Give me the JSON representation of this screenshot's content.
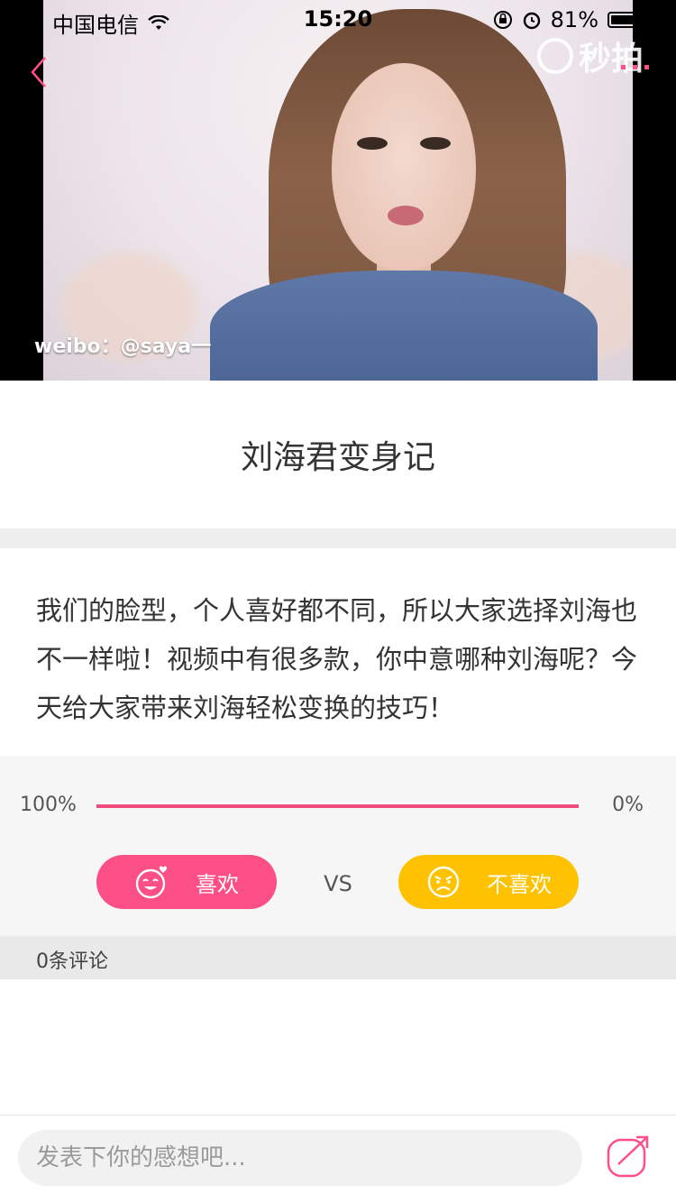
{
  "status_bar": {
    "carrier": "中国电信",
    "time": "15:20",
    "battery": "81%"
  },
  "video": {
    "watermark_user": "weibo：@saya一",
    "watermark_brand": "秒拍"
  },
  "post": {
    "title": "刘海君变身记",
    "description": "我们的脸型，个人喜好都不同，所以大家选择刘海也不一样啦！视频中有很多款，你中意哪种刘海呢？今天给大家带来刘海轻松变换的技巧！"
  },
  "vote": {
    "like_percent": "100%",
    "dislike_percent": "0%",
    "like_fraction": 1.0,
    "like_label": "喜欢",
    "vs_label": "VS",
    "dislike_label": "不喜欢"
  },
  "comments": {
    "count_label": "0条评论"
  },
  "input": {
    "placeholder": "发表下你的感想吧..."
  },
  "colors": {
    "accent_pink": "#fb4f85",
    "accent_yellow": "#ffc200"
  }
}
